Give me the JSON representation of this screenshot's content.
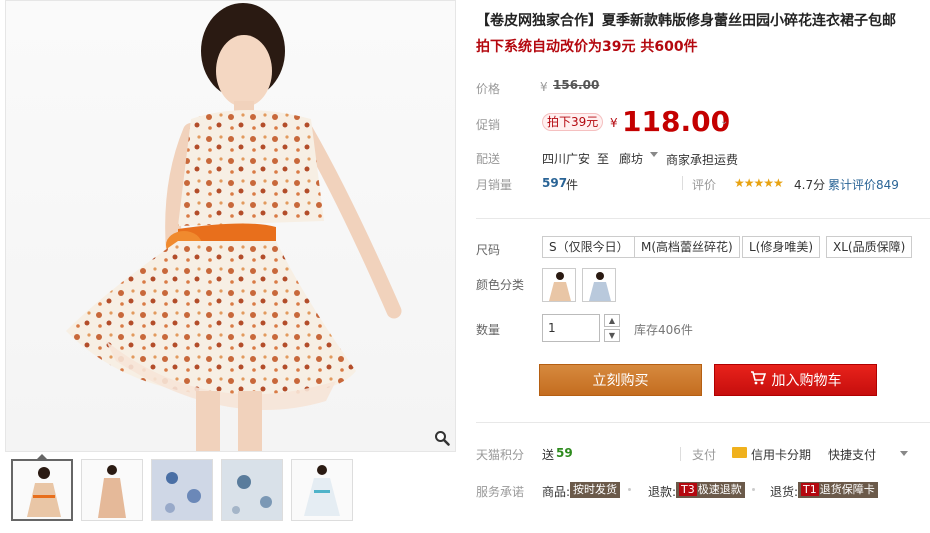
{
  "product": {
    "title": "【卷皮网独家合作】夏季新款韩版修身蕾丝田园小碎花连衣裙子包邮",
    "subtitle": "拍下系统自动改价为39元 共600件"
  },
  "price": {
    "label": "价格",
    "currency": "¥",
    "original": "156.00"
  },
  "promo": {
    "label": "促销",
    "tag": "拍下39元",
    "currency": "¥",
    "price": "118.00"
  },
  "delivery": {
    "label": "配送",
    "from": "四川广安",
    "to_word": "至",
    "to": "廊坊",
    "fee": "商家承担运费"
  },
  "sales": {
    "label": "月销量",
    "count": "597",
    "unit": "件",
    "rating_label": "评价",
    "stars": "★★★★★",
    "rating": "4.7分",
    "reviews": "累计评价849"
  },
  "sizes": {
    "label": "尺码",
    "options": [
      "S（仅限今日）",
      "M(高档蕾丝碎花)",
      "L(修身唯美)",
      "XL(品质保障)"
    ]
  },
  "colors": {
    "label": "颜色分类"
  },
  "quantity": {
    "label": "数量",
    "value": "1",
    "up": "▲",
    "down": "▼",
    "stock": "库存406件"
  },
  "buttons": {
    "buy": "立刻购买",
    "cart": "加入购物车"
  },
  "points": {
    "label": "天猫积分",
    "prefix": "送",
    "value": "59"
  },
  "payment": {
    "label": "支付",
    "credit": "信用卡分期",
    "quick": "快捷支付"
  },
  "service": {
    "label": "服务承诺",
    "goods_label": "商品:",
    "goods_badge": "按时发货",
    "refund_label": "退款:",
    "refund_t": "T3",
    "refund_badge": "极速退款",
    "return_label": "退货:",
    "return_t": "T1",
    "return_badge": "退货保障卡"
  },
  "colors_theme": {
    "price_red": "#c40000",
    "buy_orange": "#c46d20",
    "cart_red": "#c60e0d"
  }
}
